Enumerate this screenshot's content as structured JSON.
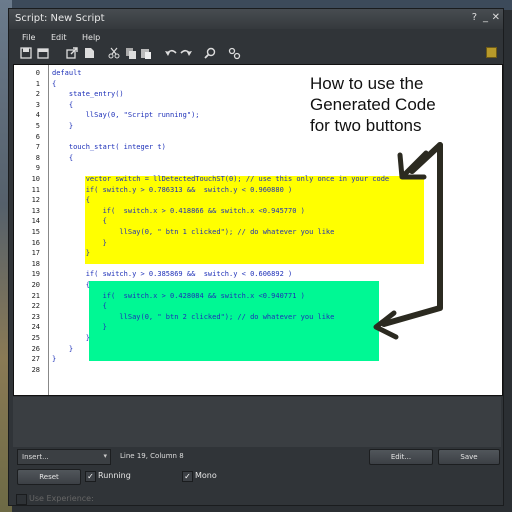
{
  "window": {
    "title": "Script: New Script",
    "help_btn": "?",
    "min_btn": "_",
    "close_btn": "✕"
  },
  "menu": {
    "file": "File",
    "edit": "Edit",
    "help": "Help"
  },
  "toolbar": [
    "save-icon",
    "open-icon",
    "export-icon",
    "cut-icon",
    "copy-icon",
    "paste-icon",
    "undo-icon",
    "redo-icon",
    "search-icon",
    "settings-icon"
  ],
  "editor": {
    "line_numbers": [
      "0",
      "1",
      "2",
      "3",
      "4",
      "5",
      "6",
      "7",
      "8",
      "9",
      "10",
      "11",
      "12",
      "13",
      "14",
      "15",
      "16",
      "17",
      "18",
      "19",
      "20",
      "21",
      "22",
      "23",
      "24",
      "25",
      "26",
      "27",
      "28"
    ],
    "lines": [
      "default",
      "{",
      "    state_entry()",
      "    {",
      "        llSay(0, \"Script running\");",
      "    }",
      "",
      "    touch_start( integer t)",
      "    {",
      "",
      "        vector switch = llDetectedTouchST(0); // use this only once in your code",
      "        if( switch.y > 0.786313 &&  switch.y < 0.960880 )",
      "        {",
      "            if(  switch.x > 0.418866 && switch.x <0.945770 )",
      "            {",
      "                llSay(0, \" btn 1 clicked\"); // do whatever you like",
      "            }",
      "        }",
      "",
      "        if( switch.y > 0.385869 &&  switch.y < 0.606892 )",
      "        {",
      "            if(  switch.x > 0.428084 && switch.x <0.940771 )",
      "            {",
      "                llSay(0, \" btn 2 clicked\"); // do whatever you like",
      "            }",
      "        }",
      "    }",
      "}"
    ]
  },
  "annotation": {
    "line1": "How to use the",
    "line2": "Generated Code",
    "line3": "for two buttons"
  },
  "footer": {
    "insert_label": "Insert...",
    "cursor_pos": "Line 19, Column 8",
    "edit_btn": "Edit...",
    "save_btn": "Save",
    "reset_btn": "Reset",
    "running_label": "Running",
    "mono_label": "Mono",
    "experience_label": "Use Experience:",
    "running_checked": true,
    "mono_checked": true,
    "experience_checked": false
  },
  "colors": {
    "highlight_yellow": "#ffff00",
    "highlight_green": "#00f894",
    "keyword": "#1c2fb8"
  }
}
